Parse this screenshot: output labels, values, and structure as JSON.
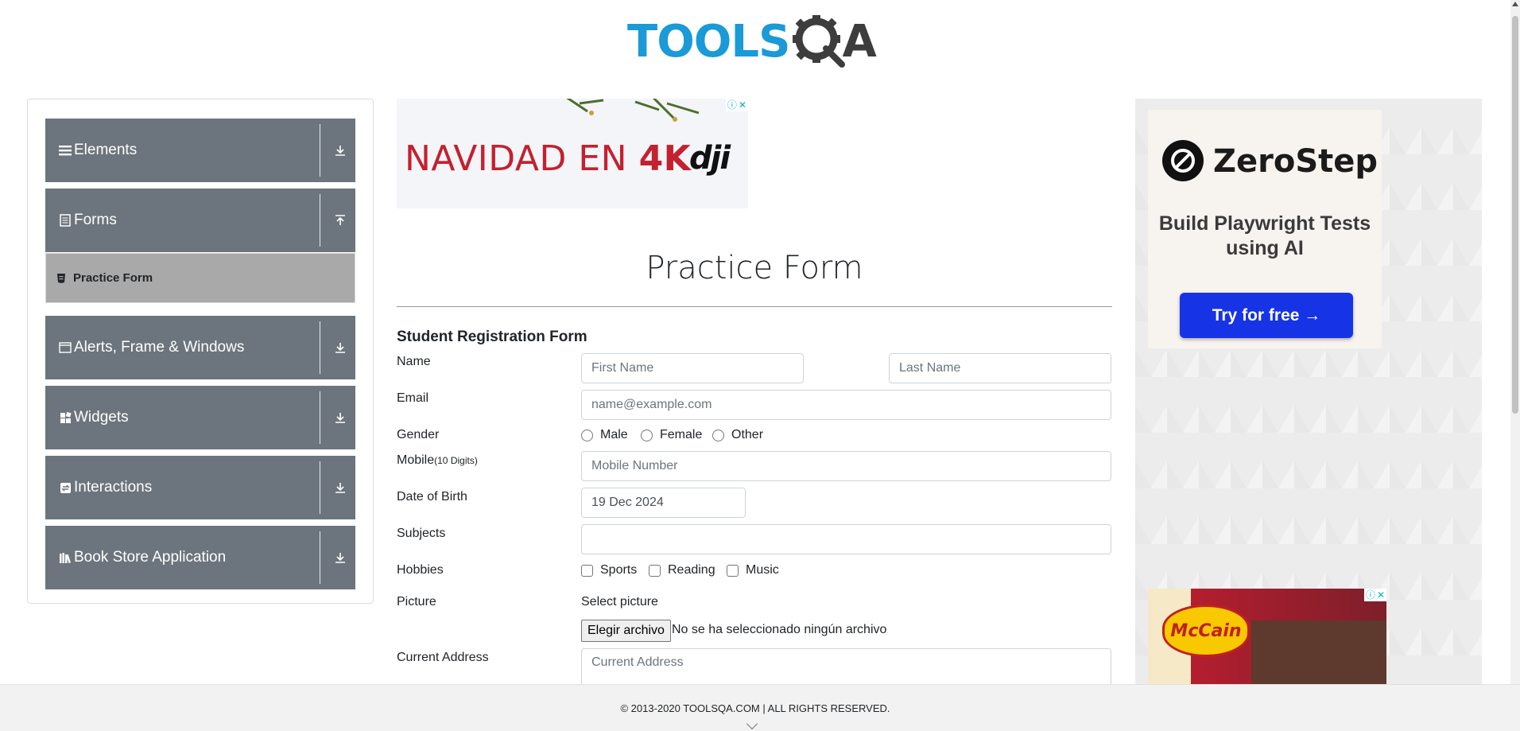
{
  "header": {
    "logo_text_left": "TOOLS",
    "logo_text_right": "A"
  },
  "sidebar": {
    "groups": [
      {
        "label": "Elements",
        "icon": "hamburger-icon",
        "expanded": false
      },
      {
        "label": "Forms",
        "icon": "document-icon",
        "expanded": true
      },
      {
        "label": "Alerts, Frame & Windows",
        "icon": "window-icon",
        "expanded": false
      },
      {
        "label": "Widgets",
        "icon": "widgets-icon",
        "expanded": false
      },
      {
        "label": "Interactions",
        "icon": "interactions-icon",
        "expanded": false
      },
      {
        "label": "Book Store Application",
        "icon": "books-icon",
        "expanded": false
      }
    ],
    "active_item": "Practice Form"
  },
  "ad_top": {
    "text_prefix": "NAVIDAD EN ",
    "text_bold": "4K",
    "brand": "dji"
  },
  "form": {
    "title": "Practice Form",
    "subtitle": "Student Registration Form",
    "name_label": "Name",
    "first_name_placeholder": "First Name",
    "last_name_placeholder": "Last Name",
    "email_label": "Email",
    "email_placeholder": "name@example.com",
    "gender_label": "Gender",
    "gender_options": [
      "Male",
      "Female",
      "Other"
    ],
    "mobile_label": "Mobile",
    "mobile_hint": "(10 Digits)",
    "mobile_placeholder": "Mobile Number",
    "dob_label": "Date of Birth",
    "dob_value": "19 Dec 2024",
    "subjects_label": "Subjects",
    "hobbies_label": "Hobbies",
    "hobby_options": [
      "Sports",
      "Reading",
      "Music"
    ],
    "picture_label": "Picture",
    "select_picture": "Select picture",
    "file_button": "Elegir archivo",
    "file_status": "No se ha seleccionado ningún archivo",
    "address_label": "Current Address",
    "address_placeholder": "Current Address"
  },
  "ad_right": {
    "brand": "ZeroStep",
    "headline": "Build Playwright Tests using AI",
    "cta": "Try for free →",
    "second_ad_brand": "McCain"
  },
  "footer": {
    "copyright": "© 2013-2020 TOOLSQA.COM | ALL RIGHTS RESERVED."
  },
  "colors": {
    "sidebar_bg": "#6c757d",
    "active_item_bg": "#a9a9a9",
    "logo_blue": "#1a9ad6",
    "cta_blue": "#1733e6"
  }
}
